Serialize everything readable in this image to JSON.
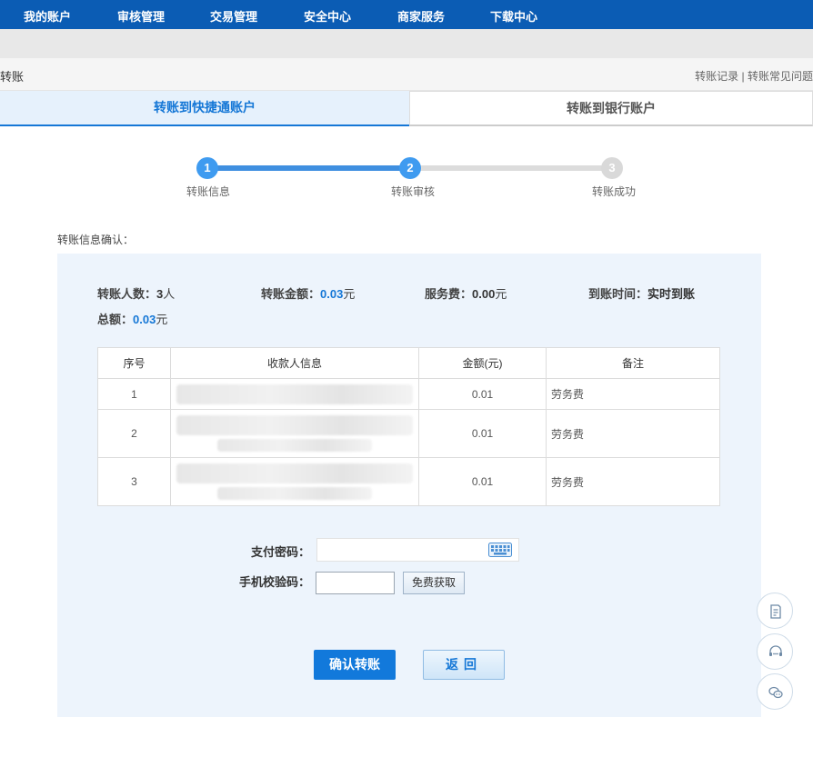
{
  "nav": [
    "我的账户",
    "审核管理",
    "交易管理",
    "安全中心",
    "商家服务",
    "下载中心"
  ],
  "page": {
    "title": "转账",
    "link_records": "转账记录",
    "separator": " | ",
    "link_faq": "转账常见问题"
  },
  "tabs": {
    "active": "转账到快捷通账户",
    "inactive": "转账到银行账户"
  },
  "steps": [
    {
      "num": "1",
      "label": "转账信息",
      "state": "done"
    },
    {
      "num": "2",
      "label": "转账审核",
      "state": "current"
    },
    {
      "num": "3",
      "label": "转账成功",
      "state": "todo"
    }
  ],
  "confirm_title": "转账信息确认：",
  "summary": {
    "count_label": "转账人数：",
    "count_value": "3",
    "count_unit": "人",
    "amount_label": "转账金额：",
    "amount_value": "0.03",
    "amount_unit": "元",
    "fee_label": "服务费：",
    "fee_value": "0.00",
    "fee_unit": "元",
    "arrival_label": "到账时间：",
    "arrival_value": "实时到账",
    "total_label": "总额：",
    "total_value": "0.03",
    "total_unit": "元"
  },
  "table": {
    "headers": [
      "序号",
      "收款人信息",
      "金额(元)",
      "备注"
    ],
    "rows": [
      {
        "no": "1",
        "amount": "0.01",
        "note": "劳务费"
      },
      {
        "no": "2",
        "amount": "0.01",
        "note": "劳务费"
      },
      {
        "no": "3",
        "amount": "0.01",
        "note": "劳务费"
      }
    ]
  },
  "form": {
    "password_label": "支付密码：",
    "sms_label": "手机校验码：",
    "get_code_label": "免费获取"
  },
  "buttons": {
    "confirm": "确认转账",
    "back": "返回"
  },
  "colors": {
    "nav_bg": "#0b5cb4",
    "accent": "#1577d6",
    "panel_bg": "#edf4fc"
  },
  "floating_icons": [
    "document-icon",
    "customer-service-icon",
    "chat-icon"
  ]
}
